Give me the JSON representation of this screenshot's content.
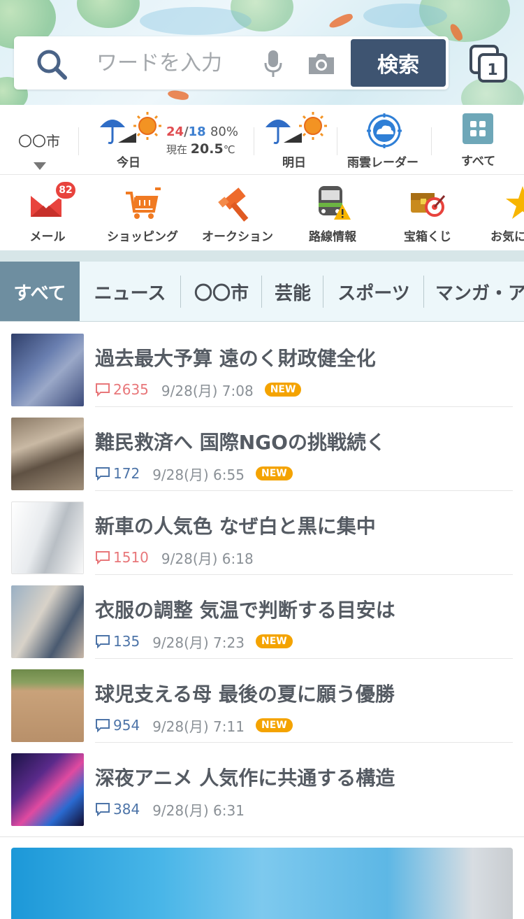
{
  "search": {
    "placeholder": "ワードを入力",
    "button_label": "検索",
    "tab_count": "1"
  },
  "weather": {
    "city": "〇〇市",
    "today_label": "今日",
    "high": "24",
    "sep": "/",
    "low": "18",
    "precip": "80%",
    "now_label": "現在",
    "now_temp": "20.5",
    "now_unit": "℃",
    "tomorrow_label": "明日",
    "radar_label": "雨雲レーダー",
    "all_label": "すべて"
  },
  "services": [
    {
      "label": "メール",
      "icon": "mail-icon",
      "badge": "82"
    },
    {
      "label": "ショッピング",
      "icon": "cart-icon"
    },
    {
      "label": "オークション",
      "icon": "gavel-icon"
    },
    {
      "label": "路線情報",
      "icon": "train-icon"
    },
    {
      "label": "宝箱くじ",
      "icon": "treasure-icon"
    },
    {
      "label": "お気に",
      "icon": "star-icon"
    }
  ],
  "category_tabs": [
    "すべて",
    "ニュース",
    "〇〇市",
    "芸能",
    "スポーツ",
    "マンガ・ア"
  ],
  "news": [
    {
      "headline": "過去最大予算 遠のく財政健全化",
      "comments": "2635",
      "hot": true,
      "time": "9/28(月) 7:08",
      "new": "NEW"
    },
    {
      "headline": "難民救済へ 国際NGOの挑戦続く",
      "comments": "172",
      "hot": false,
      "time": "9/28(月) 6:55",
      "new": "NEW"
    },
    {
      "headline": "新車の人気色 なぜ白と黒に集中",
      "comments": "1510",
      "hot": true,
      "time": "9/28(月) 6:18",
      "new": ""
    },
    {
      "headline": "衣服の調整 気温で判断する目安は",
      "comments": "135",
      "hot": false,
      "time": "9/28(月) 7:23",
      "new": "NEW"
    },
    {
      "headline": "球児支える母 最後の夏に願う優勝",
      "comments": "954",
      "hot": false,
      "time": "9/28(月) 7:11",
      "new": "NEW"
    },
    {
      "headline": "深夜アニメ 人気作に共通する構造",
      "comments": "384",
      "hot": false,
      "time": "9/28(月) 6:31",
      "new": ""
    }
  ],
  "colors": {
    "accent": "#3e5471",
    "hot_count": "#e8777a",
    "normal_count": "#4d74a8",
    "new_badge": "#f4a300",
    "active_tab": "#6e8ea0"
  }
}
